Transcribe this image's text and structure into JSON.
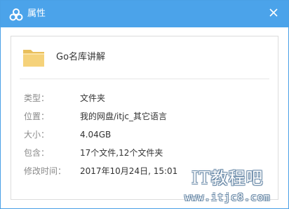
{
  "window": {
    "title": "属性",
    "app_icon": "baidu-netdisk-cloud-icon",
    "close_icon": "close-icon"
  },
  "file": {
    "icon": "folder-icon",
    "name": "Go名库讲解"
  },
  "properties": [
    {
      "label": "类型：",
      "value": "文件夹"
    },
    {
      "label": "位置：",
      "value": "我的网盘/itjc_其它语言"
    },
    {
      "label": "大小：",
      "value": "4.04GB"
    },
    {
      "label": "包含：",
      "value": "17个文件,12个文件夹"
    },
    {
      "label": "修改时间：",
      "value": "2017年10月24日, 15:01"
    }
  ],
  "watermark": {
    "main": "IT教程吧",
    "sub": "www.itjc8.com"
  },
  "colors": {
    "titlebar": "#4ba3ea",
    "border": "#4aa0e6",
    "folder": "#f5d27a"
  }
}
